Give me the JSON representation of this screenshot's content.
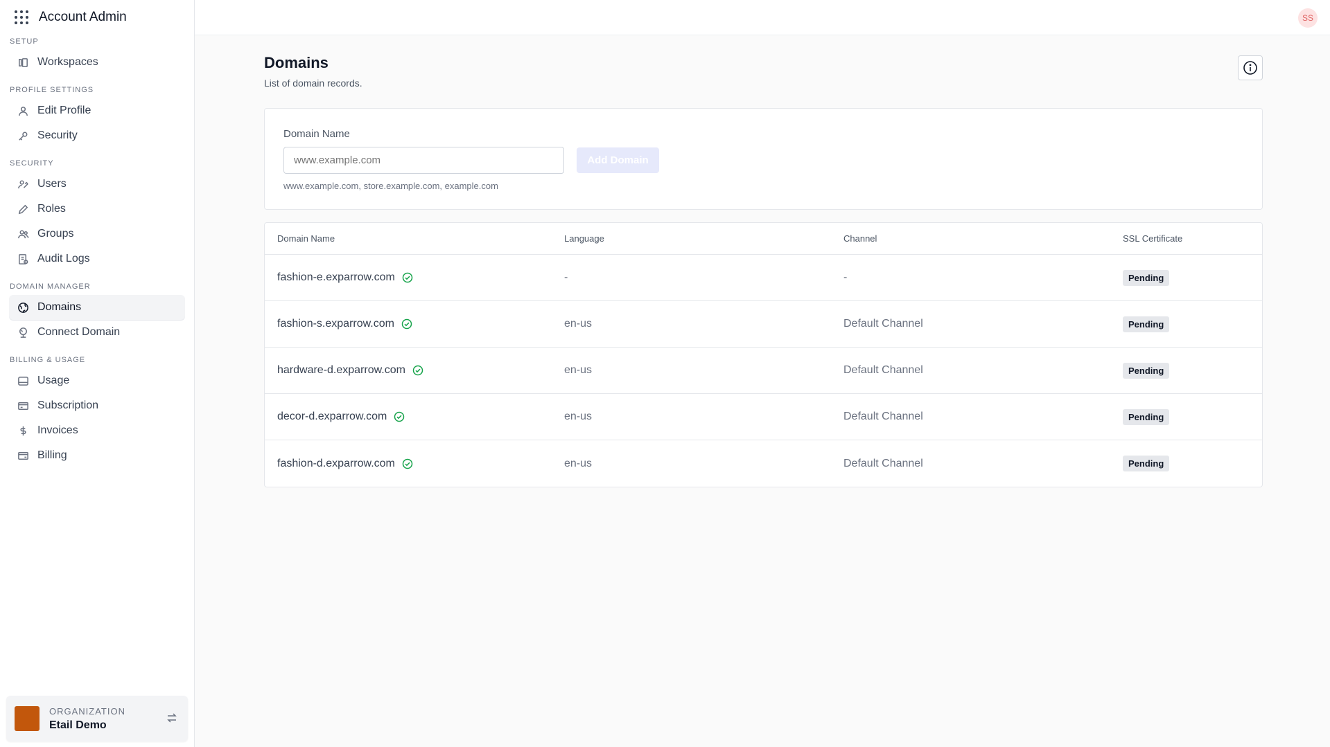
{
  "app": {
    "title": "Account Admin"
  },
  "user": {
    "initials": "SS"
  },
  "sidebar": {
    "sections": [
      {
        "title": "Setup",
        "items": [
          {
            "label": "Workspaces",
            "icon": "workspaces-icon"
          }
        ]
      },
      {
        "title": "Profile Settings",
        "items": [
          {
            "label": "Edit Profile",
            "icon": "user-icon"
          },
          {
            "label": "Security",
            "icon": "key-icon"
          }
        ]
      },
      {
        "title": "Security",
        "items": [
          {
            "label": "Users",
            "icon": "users-icon"
          },
          {
            "label": "Roles",
            "icon": "pen-icon"
          },
          {
            "label": "Groups",
            "icon": "group-icon"
          },
          {
            "label": "Audit Logs",
            "icon": "audit-icon"
          }
        ]
      },
      {
        "title": "Domain Manager",
        "items": [
          {
            "label": "Domains",
            "icon": "globe-icon",
            "active": true
          },
          {
            "label": "Connect Domain",
            "icon": "globe-connect-icon"
          }
        ]
      },
      {
        "title": "Billing & Usage",
        "items": [
          {
            "label": "Usage",
            "icon": "usage-icon"
          },
          {
            "label": "Subscription",
            "icon": "card-icon"
          },
          {
            "label": "Invoices",
            "icon": "dollar-icon"
          },
          {
            "label": "Billing",
            "icon": "billing-icon"
          }
        ]
      }
    ],
    "organization": {
      "label": "Organization",
      "name": "Etail Demo",
      "color": "#c2570c"
    }
  },
  "page": {
    "title": "Domains",
    "subtitle": "List of domain records."
  },
  "form": {
    "label": "Domain Name",
    "placeholder": "www.example.com",
    "button": "Add Domain",
    "hint": "www.example.com, store.example.com, example.com"
  },
  "table": {
    "headers": [
      "Domain Name",
      "Language",
      "Channel",
      "SSL Certificate"
    ],
    "rows": [
      {
        "domain": "fashion-e.exparrow.com",
        "language": "-",
        "channel": "-",
        "ssl": "Pending"
      },
      {
        "domain": "fashion-s.exparrow.com",
        "language": "en-us",
        "channel": "Default Channel",
        "ssl": "Pending"
      },
      {
        "domain": "hardware-d.exparrow.com",
        "language": "en-us",
        "channel": "Default Channel",
        "ssl": "Pending"
      },
      {
        "domain": "decor-d.exparrow.com",
        "language": "en-us",
        "channel": "Default Channel",
        "ssl": "Pending"
      },
      {
        "domain": "fashion-d.exparrow.com",
        "language": "en-us",
        "channel": "Default Channel",
        "ssl": "Pending"
      }
    ]
  },
  "colors": {
    "accent_disabled": "#e6e9fb",
    "verified": "#16a34a",
    "org": "#c2570c"
  }
}
